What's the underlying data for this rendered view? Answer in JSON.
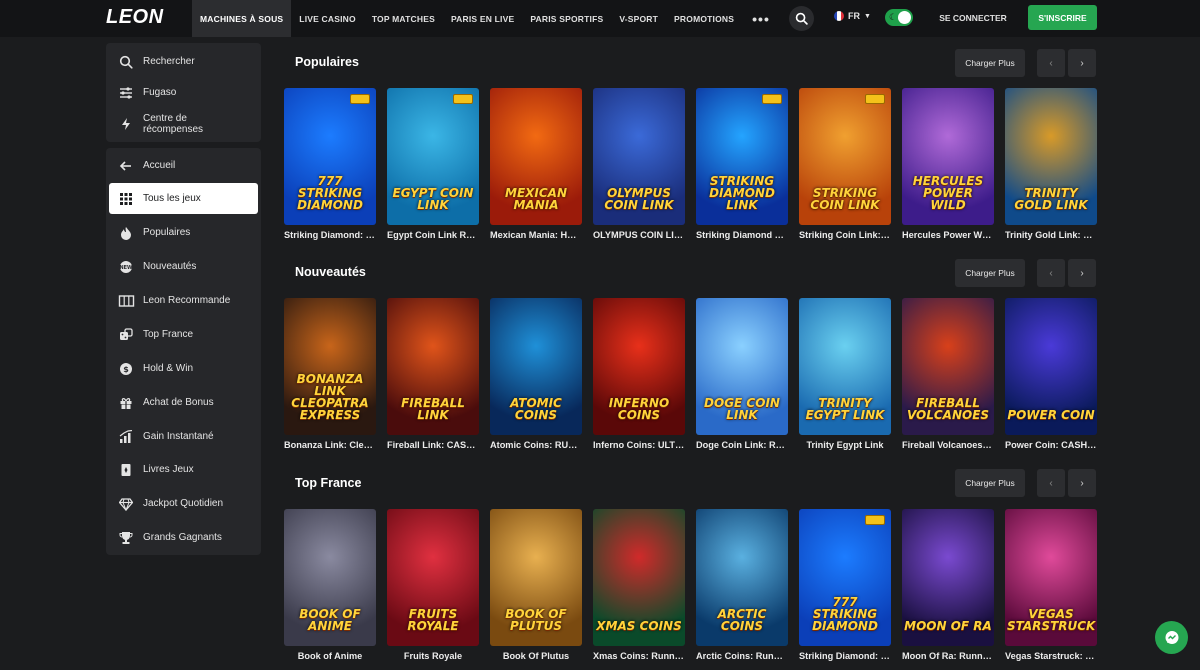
{
  "header": {
    "logo": "LEON",
    "nav": [
      {
        "label": "MACHINES À SOUS",
        "active": true
      },
      {
        "label": "LIVE CASINO",
        "active": false
      },
      {
        "label": "TOP MATCHES",
        "active": false
      },
      {
        "label": "PARIS EN LIVE",
        "active": false
      },
      {
        "label": "PARIS SPORTIFS",
        "active": false
      },
      {
        "label": "V-SPORT",
        "active": false
      },
      {
        "label": "PROMOTIONS",
        "active": false
      }
    ],
    "more": "•••",
    "lang": "FR",
    "login": "SE CONNECTER",
    "signup": "S'INSCRIRE"
  },
  "sidebar": {
    "top": [
      {
        "label": "Rechercher",
        "icon": "search-icon"
      },
      {
        "label": "Fugaso",
        "icon": "sliders-icon"
      },
      {
        "label": "Centre de récompenses",
        "icon": "bolt-icon"
      }
    ],
    "items": [
      {
        "label": "Accueil",
        "icon": "arrow-left-icon"
      },
      {
        "label": "Tous les jeux",
        "icon": "grid-icon",
        "active": true
      },
      {
        "label": "Populaires",
        "icon": "flame-icon"
      },
      {
        "label": "Nouveautés",
        "icon": "new-badge-icon"
      },
      {
        "label": "Leon Recommande",
        "icon": "slot-machine-icon"
      },
      {
        "label": "Top France",
        "icon": "dice-icon"
      },
      {
        "label": "Hold & Win",
        "icon": "coin-icon"
      },
      {
        "label": "Achat de Bonus",
        "icon": "gift-icon"
      },
      {
        "label": "Gain Instantané",
        "icon": "chart-icon"
      },
      {
        "label": "Livres Jeux",
        "icon": "book-icon"
      },
      {
        "label": "Jackpot Quotidien",
        "icon": "diamond-icon"
      },
      {
        "label": "Grands Gagnants",
        "icon": "trophy-icon"
      }
    ]
  },
  "sections": [
    {
      "title": "Populaires",
      "more": "Charger Plus",
      "games": [
        {
          "name": "Striking Diamond: …",
          "art": "777 STRIKING DIAMOND",
          "bg": [
            "#0b3fb8",
            "#1c7cff"
          ],
          "badge": true
        },
        {
          "name": "Egypt Coin Link R…",
          "art": "EGYPT COIN LINK",
          "bg": [
            "#0d6ea8",
            "#3bb6e6"
          ],
          "badge": true
        },
        {
          "name": "Mexican Mania: H…",
          "art": "MEXICAN MANIA",
          "bg": [
            "#9b1b0a",
            "#f26a12"
          ],
          "badge": false
        },
        {
          "name": "OLYMPUS COIN LI…",
          "art": "OLYMPUS COIN LINK",
          "bg": [
            "#1a2d7a",
            "#3b6ad8"
          ],
          "badge": false
        },
        {
          "name": "Striking Diamond …",
          "art": "STRIKING DIAMOND LINK",
          "bg": [
            "#0a2f9a",
            "#24a4ff"
          ],
          "badge": true
        },
        {
          "name": "Striking Coin Link:…",
          "art": "STRIKING COIN LINK",
          "bg": [
            "#b8420a",
            "#f0a030"
          ],
          "badge": true
        },
        {
          "name": "Hercules Power W…",
          "art": "HERCULES POWER WILD",
          "bg": [
            "#3d1c8a",
            "#b06ad8"
          ],
          "badge": false
        },
        {
          "name": "Trinity Gold Link: …",
          "art": "TRINITY GOLD LINK",
          "bg": [
            "#0f4a8a",
            "#d89a28"
          ],
          "badge": false
        }
      ]
    },
    {
      "title": "Nouveautés",
      "more": "Charger Plus",
      "games": [
        {
          "name": "Bonanza Link: Cle…",
          "art": "BONANZA LINK CLEOPATRA EXPRESS",
          "bg": [
            "#2a1810",
            "#c8651a"
          ],
          "badge": false
        },
        {
          "name": "Fireball Link: CAS…",
          "art": "FIREBALL LINK",
          "bg": [
            "#4a0c0c",
            "#e0541a"
          ],
          "badge": false
        },
        {
          "name": "Atomic Coins: RU…",
          "art": "ATOMIC COINS",
          "bg": [
            "#08285a",
            "#1f90d8"
          ],
          "badge": false
        },
        {
          "name": "Inferno Coins: ULT…",
          "art": "INFERNO COINS",
          "bg": [
            "#5a0808",
            "#e8301a"
          ],
          "badge": false
        },
        {
          "name": "Doge Coin Link: R…",
          "art": "DOGE COIN LINK",
          "bg": [
            "#2a6ac8",
            "#8ad0ff"
          ],
          "badge": false
        },
        {
          "name": "Trinity Egypt Link",
          "art": "TRINITY EGYPT LINK",
          "bg": [
            "#1a6ab0",
            "#6ad0f0"
          ],
          "badge": false
        },
        {
          "name": "Fireball Volcanoes…",
          "art": "FIREBALL VOLCANOES",
          "bg": [
            "#2a1a4a",
            "#d8401a"
          ],
          "badge": false
        },
        {
          "name": "Power Coin: CASH…",
          "art": "POWER COIN",
          "bg": [
            "#0a1a5a",
            "#4a3ad8"
          ],
          "badge": false
        }
      ]
    },
    {
      "title": "Top France",
      "more": "Charger Plus",
      "games": [
        {
          "name": "Book of Anime",
          "art": "BOOK OF ANIME",
          "bg": [
            "#3a3a4a",
            "#8a8aa0"
          ],
          "badge": false
        },
        {
          "name": "Fruits Royale",
          "art": "FRUITS ROYALE",
          "bg": [
            "#6a0a14",
            "#e03040"
          ],
          "badge": false
        },
        {
          "name": "Book Of Plutus",
          "art": "BOOK OF PLUTUS",
          "bg": [
            "#7a4a10",
            "#e8b050"
          ],
          "badge": false
        },
        {
          "name": "Xmas Coins: Runn…",
          "art": "XMAS COINS",
          "bg": [
            "#0a4a2a",
            "#d02a2a"
          ],
          "badge": false
        },
        {
          "name": "Arctic Coins: Runn…",
          "art": "ARCTIC COINS",
          "bg": [
            "#0a3a6a",
            "#5ab0e0"
          ],
          "badge": false
        },
        {
          "name": "Striking Diamond: …",
          "art": "777 STRIKING DIAMOND",
          "bg": [
            "#0b3fb8",
            "#1c7cff"
          ],
          "badge": true
        },
        {
          "name": "Moon Of Ra: Runni…",
          "art": "MOON OF RA",
          "bg": [
            "#1a1040",
            "#7a4ad0"
          ],
          "badge": false
        },
        {
          "name": "Vegas Starstruck: …",
          "art": "VEGAS STARSTRUCK",
          "bg": [
            "#5a0a3a",
            "#e04a9a"
          ],
          "badge": false
        }
      ]
    }
  ],
  "colors": {
    "accent": "#26a651",
    "bg": "#1b1c1e",
    "panel": "#26272a",
    "header": "#131416"
  }
}
